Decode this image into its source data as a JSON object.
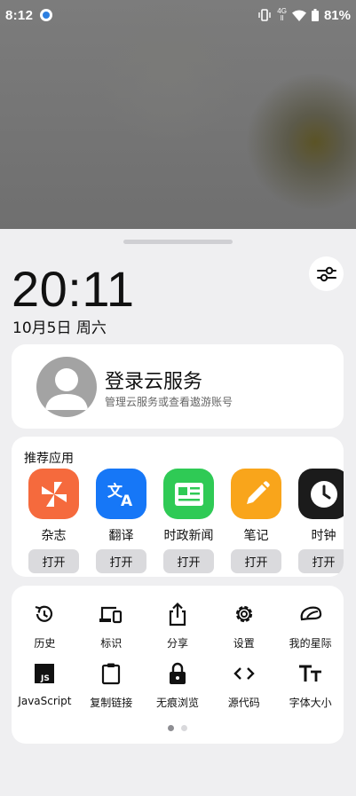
{
  "status_bar": {
    "time": "8:12",
    "network_line1": "4G",
    "network_line2": "ll",
    "battery": "81%"
  },
  "panel": {
    "clock": "20:11",
    "date": "10月5日 周六"
  },
  "account": {
    "title": "登录云服务",
    "subtitle": "管理云服务或查看遨游账号"
  },
  "recommended": {
    "title": "推荐应用",
    "apps": [
      {
        "name": "杂志",
        "action": "打开",
        "color": "#f56a3d",
        "icon": "pinwheel-icon"
      },
      {
        "name": "翻译",
        "action": "打开",
        "color": "#1677f7",
        "icon": "translate-icon"
      },
      {
        "name": "时政新闻",
        "action": "打开",
        "color": "#2fca55",
        "icon": "news-icon"
      },
      {
        "name": "笔记",
        "action": "打开",
        "color": "#f9a51b",
        "icon": "pencil-icon"
      },
      {
        "name": "时钟",
        "action": "打开",
        "color": "#1b1b1b",
        "icon": "clock-icon"
      }
    ]
  },
  "tools": {
    "items": [
      {
        "label": "历史",
        "icon": "history-icon"
      },
      {
        "label": "标识",
        "icon": "devices-icon"
      },
      {
        "label": "分享",
        "icon": "share-icon"
      },
      {
        "label": "设置",
        "icon": "gear-icon"
      },
      {
        "label": "我的星际",
        "icon": "planet-icon"
      },
      {
        "label": "JavaScript",
        "icon": "javascript-icon"
      },
      {
        "label": "复制链接",
        "icon": "clipboard-icon"
      },
      {
        "label": "无痕浏览",
        "icon": "lock-icon"
      },
      {
        "label": "源代码",
        "icon": "code-icon"
      },
      {
        "label": "字体大小",
        "icon": "font-size-icon"
      }
    ],
    "page_count": 2,
    "current_page": 1
  }
}
